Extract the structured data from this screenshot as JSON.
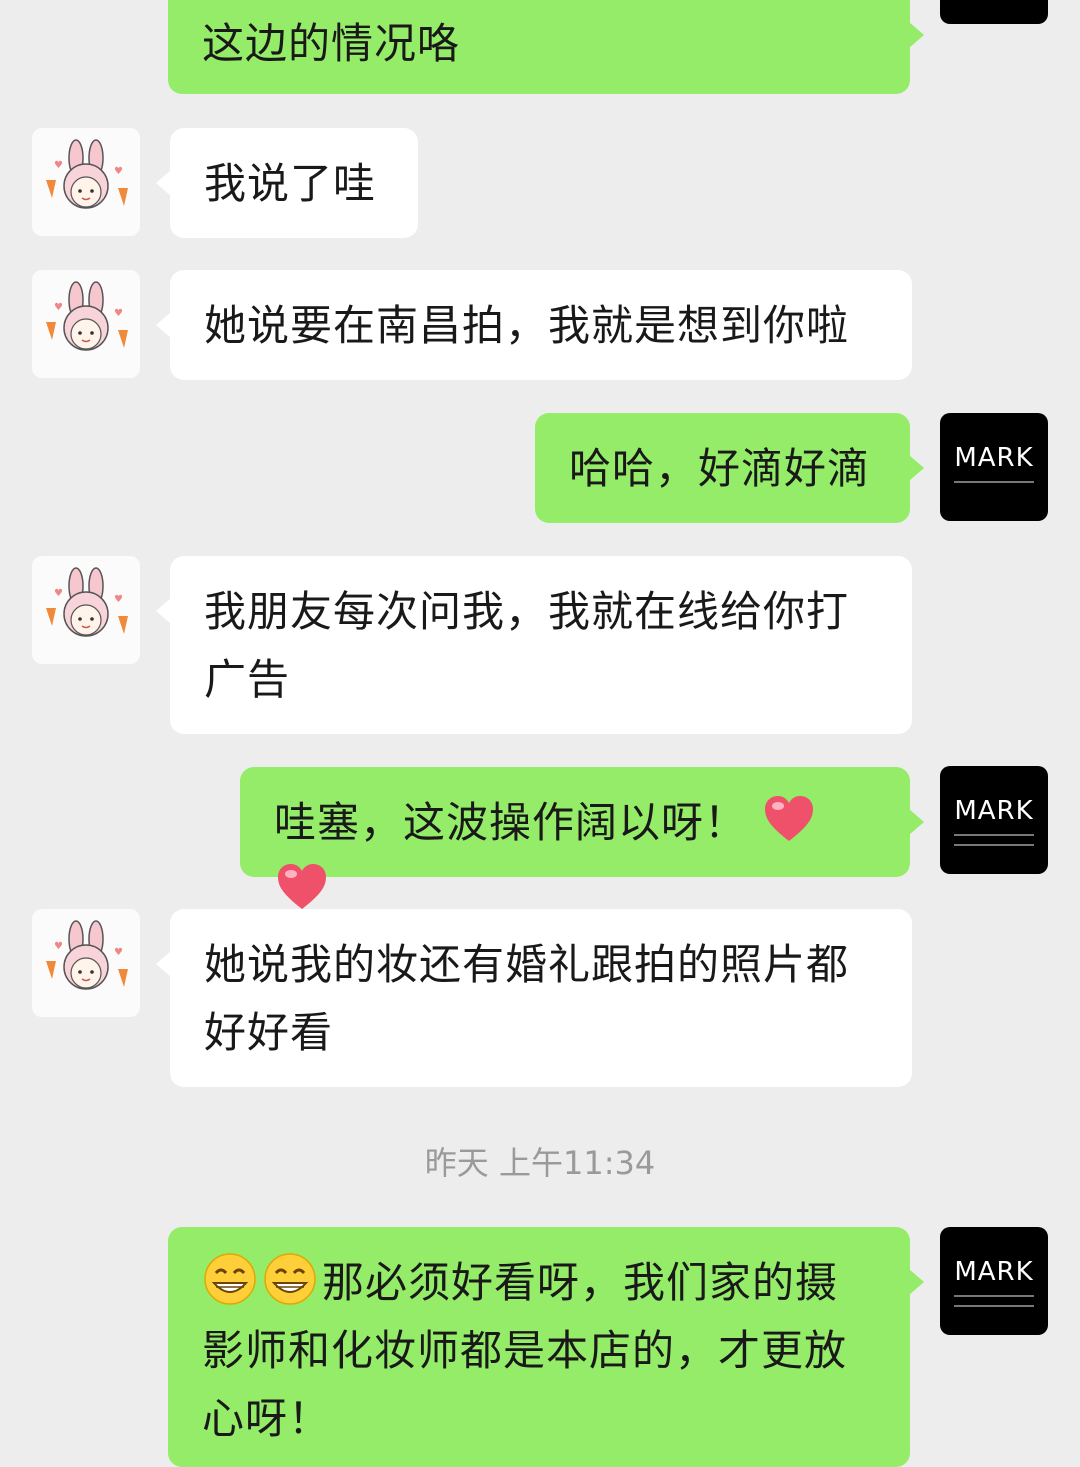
{
  "chat": {
    "timestamp": "昨天 上午11:34",
    "avatars": {
      "contact_icon": "bunny-hat-girl-avatar",
      "self_icon": "mark-logo-avatar",
      "self_logo_text": "MARK"
    },
    "messages": [
      {
        "side": "out",
        "text": "这边的情况咯"
      },
      {
        "side": "in",
        "text": "我说了哇"
      },
      {
        "side": "in",
        "text": "她说要在南昌拍，我就是想到你啦"
      },
      {
        "side": "out",
        "text": "哈哈，好滴好滴"
      },
      {
        "side": "in",
        "text": "我朋友每次问我，我就在线给你打广告"
      },
      {
        "side": "out",
        "text": "哇塞，这波操作阔以呀！",
        "emojis": [
          "red-heart",
          "red-heart"
        ]
      },
      {
        "side": "in",
        "text": "她说我的妆还有婚礼跟拍的照片都好好看"
      },
      {
        "side": "out",
        "text": "那必须好看呀，我们家的摄影师和化妆师都是本店的，才更放心呀！",
        "leading_emojis": [
          "grinning-face",
          "grinning-face"
        ]
      }
    ]
  },
  "colors": {
    "background": "#ededed",
    "outgoing_bubble": "#95ec69",
    "incoming_bubble": "#ffffff",
    "timestamp_text": "#9a9a9a"
  }
}
